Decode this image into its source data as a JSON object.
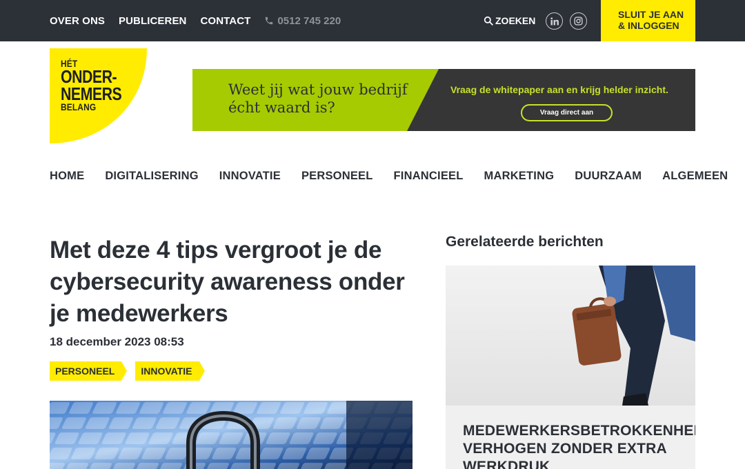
{
  "topbar": {
    "links": [
      "OVER ONS",
      "PUBLICEREN",
      "CONTACT"
    ],
    "phone": "0512 745 220",
    "search_label": "ZOEKEN",
    "join_line1": "SLUIT JE AAN",
    "join_line2": "& INLOGGEN",
    "icons": [
      "phone-icon",
      "search-icon",
      "linkedin-icon",
      "instagram-icon"
    ]
  },
  "logo": {
    "line1": "HÉT",
    "line2": "ONDER-",
    "line3": "NEMERS",
    "line4": "BELANG",
    "color": "#ffec00"
  },
  "banner": {
    "headline_line1": "Weet jij wat jouw bedrijf",
    "headline_line2": "écht waard is?",
    "subline": "Vraag de whitepaper aan en krijg helder inzicht.",
    "button": "Vraag direct aan",
    "green": "#a6cb00",
    "dark": "#363636"
  },
  "nav": {
    "items": [
      "HOME",
      "DIGITALISERING",
      "INNOVATIE",
      "PERSONEEL",
      "FINANCIEEL",
      "MARKETING",
      "DUURZAAM",
      "ALGEMEEN"
    ]
  },
  "article": {
    "title": "Met deze 4 tips vergroot je de cybersecurity awareness onder je medewerkers",
    "date": "18 december 2023 08:53",
    "tags": [
      "PERSONEEL",
      "INNOVATIE"
    ]
  },
  "sidebar": {
    "heading": "Gerelateerde berichten",
    "card_title": "MEDEWERKERSBETROKKENHEID VERHOGEN ZONDER EXTRA WERKDRUK"
  },
  "colors": {
    "topbar": "#2c3037",
    "accent_yellow": "#ffec00",
    "text": "#2b2f36"
  }
}
